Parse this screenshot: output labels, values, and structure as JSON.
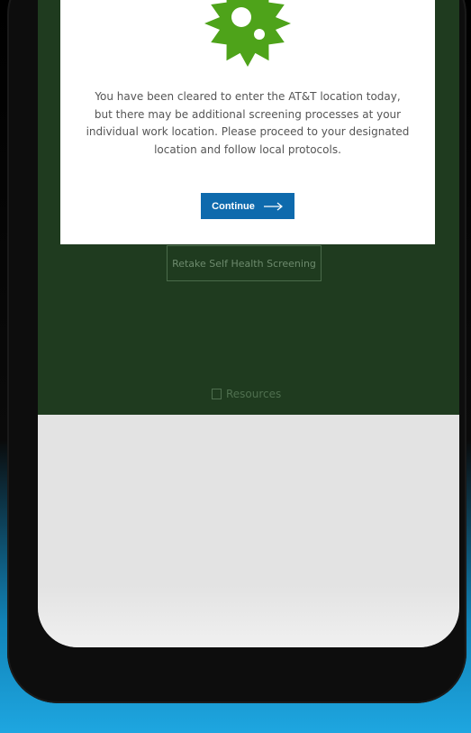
{
  "modal": {
    "message": "You have been cleared to enter the AT&T location today, but there may be additional screening processes at your individual work location. Please proceed to your designated location and follow local protocols.",
    "continue_label": "Continue",
    "badge_icon": "cleared-badge-icon",
    "badge_color": "#4ea31a",
    "button_color": "#0e6aad"
  },
  "screen": {
    "retake_label": "Retake Self Health Screening",
    "resources_label": "Resources",
    "background_color": "#1f3b1f"
  }
}
